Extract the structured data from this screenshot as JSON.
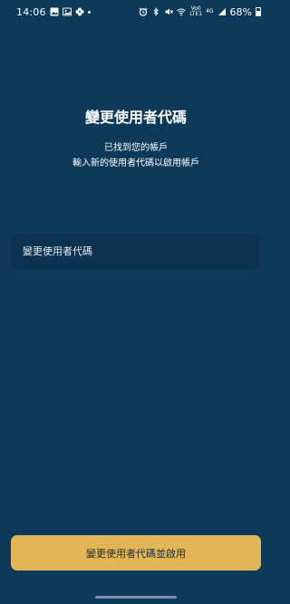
{
  "status_bar": {
    "time": "14:06",
    "left_icons": [
      "image-icon",
      "gallery-icon",
      "flower-icon",
      "dot-icon"
    ],
    "right_icons": [
      "alarm-icon",
      "bluetooth-icon",
      "mute-icon",
      "wifi-icon",
      "volte-icon",
      "signal-icon",
      "battery-icon"
    ],
    "network_top": "Vo0",
    "network_bottom": "LTE1",
    "network_type": "4G",
    "battery_percent": "68%"
  },
  "header": {
    "title": "變更使用者代碼",
    "subtitle_line1": "已找到您的帳戶",
    "subtitle_line2": "輸入新的使用者代碼以啟用帳戶"
  },
  "form": {
    "username_placeholder": "變更使用者代碼",
    "username_value": ""
  },
  "actions": {
    "submit_label": "變更使用者代碼並啟用"
  },
  "colors": {
    "background": "#0d3a5a",
    "input_background": "#0b3250",
    "button_background": "#e2b657",
    "button_text": "#1d2a36"
  }
}
